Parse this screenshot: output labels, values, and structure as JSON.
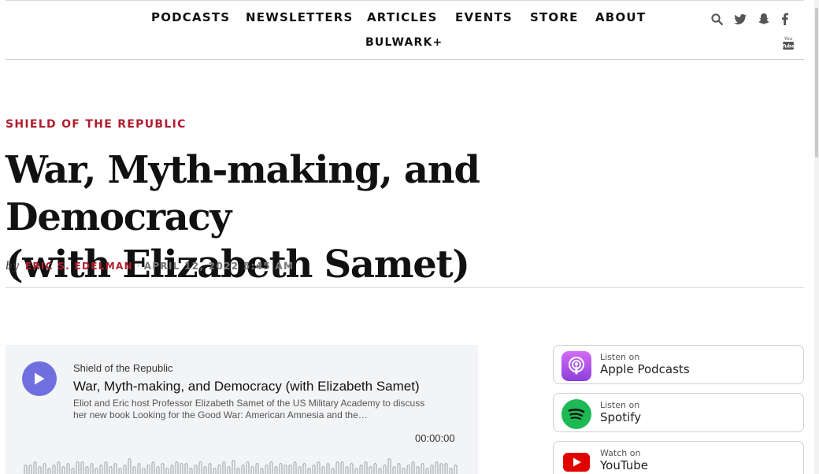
{
  "nav": {
    "items": [
      "PODCASTS",
      "NEWSLETTERS",
      "ARTICLES",
      "EVENTS",
      "STORE",
      "ABOUT"
    ],
    "second_row": "BULWARK+",
    "social_icons": [
      "search-icon",
      "twitter-icon",
      "snapchat-icon",
      "facebook-icon",
      "youtube-icon"
    ]
  },
  "article": {
    "kicker": "SHIELD OF THE REPUBLIC",
    "title_line1": "War, Myth-making, and Democracy",
    "title_line2": "(with Elizabeth Samet)",
    "byline_prefix": "by",
    "author": "ERIC S. EDELMAN",
    "separator": "·",
    "date": "APRIL 12, 2022 5:45 AM"
  },
  "player": {
    "show": "Shield of the Republic",
    "episode_title": "War, Myth-making, and Democracy (with Elizabeth Samet)",
    "description": "Eliot and Eric host Professor Elizabeth Samet of the US Military Academy to discuss her new book Looking for the Good War: American Amnesia and the…",
    "time": "00:00:00",
    "accent_color": "#6f6fe0"
  },
  "listen_on": [
    {
      "small": "Listen on",
      "big": "Apple Podcasts",
      "icon": "apple-podcasts-icon",
      "color": "#a855f7"
    },
    {
      "small": "Listen on",
      "big": "Spotify",
      "icon": "spotify-icon",
      "color": "#1db954"
    },
    {
      "small": "Watch on",
      "big": "YouTube",
      "icon": "youtube-icon",
      "color": "#e00000"
    }
  ],
  "colors": {
    "brand_red": "#b01c2e"
  }
}
